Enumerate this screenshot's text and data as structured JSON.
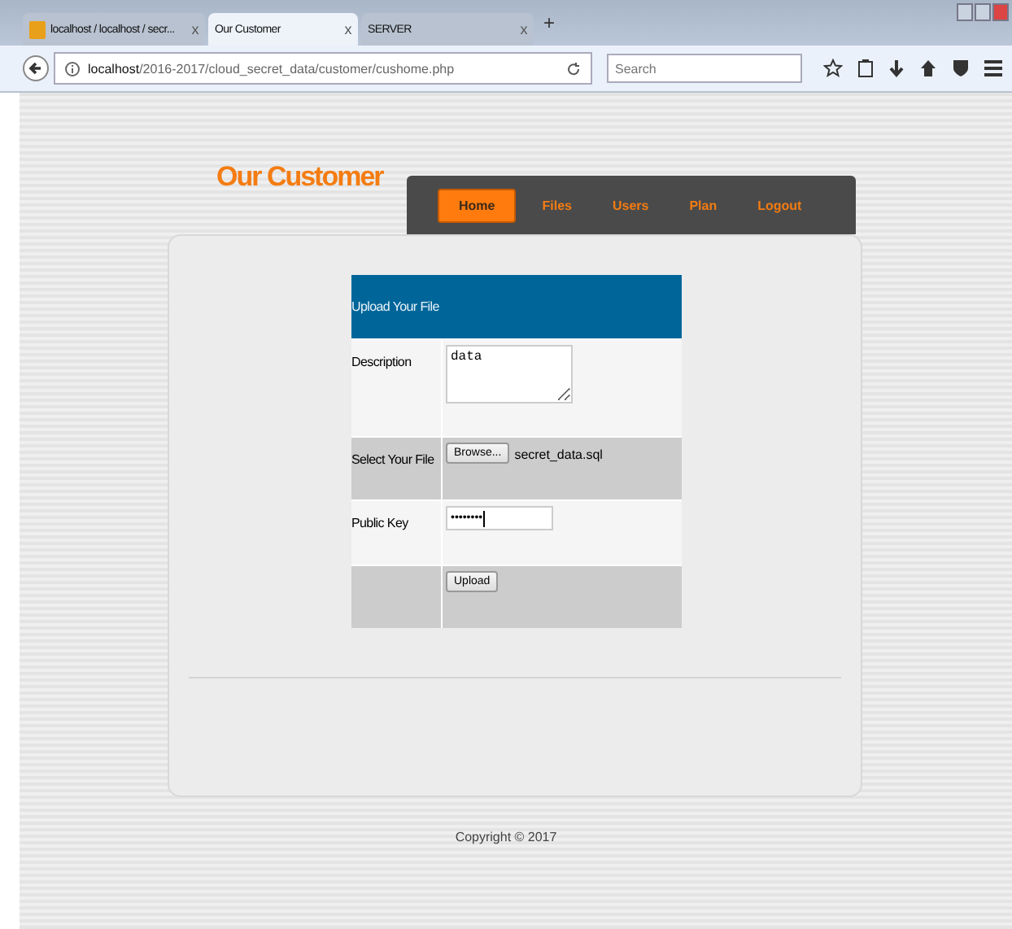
{
  "browser": {
    "tabs": [
      {
        "label": "localhost / localhost / secr...",
        "selected": false,
        "close": "x"
      },
      {
        "label": "Our Customer",
        "selected": true,
        "close": "x"
      },
      {
        "label": "SERVER",
        "selected": false,
        "close": "x"
      }
    ],
    "new_tab": "+",
    "url_host": "localhost",
    "url_path": "/2016-2017/cloud_secret_data/customer/cushome.php",
    "search": {
      "placeholder": "Search"
    }
  },
  "site_title": "Our Customer",
  "nav": [
    {
      "label": "Home",
      "selected": true
    },
    {
      "label": "Files",
      "selected": false
    },
    {
      "label": "Users",
      "selected": false
    },
    {
      "label": "Plan",
      "selected": false
    },
    {
      "label": "Logout",
      "selected": false
    }
  ],
  "form": {
    "header": "Upload Your File",
    "rows": [
      {
        "kind": "textarea",
        "label": "Description",
        "value": "data"
      },
      {
        "kind": "file",
        "label": "Select Your File",
        "button": "Browse...",
        "file": "secret_data.sql"
      },
      {
        "kind": "password",
        "label": "Public Key",
        "value": "••••••••"
      },
      {
        "kind": "submit",
        "button": "Upload"
      }
    ]
  },
  "footer": "Copyright © 2017"
}
